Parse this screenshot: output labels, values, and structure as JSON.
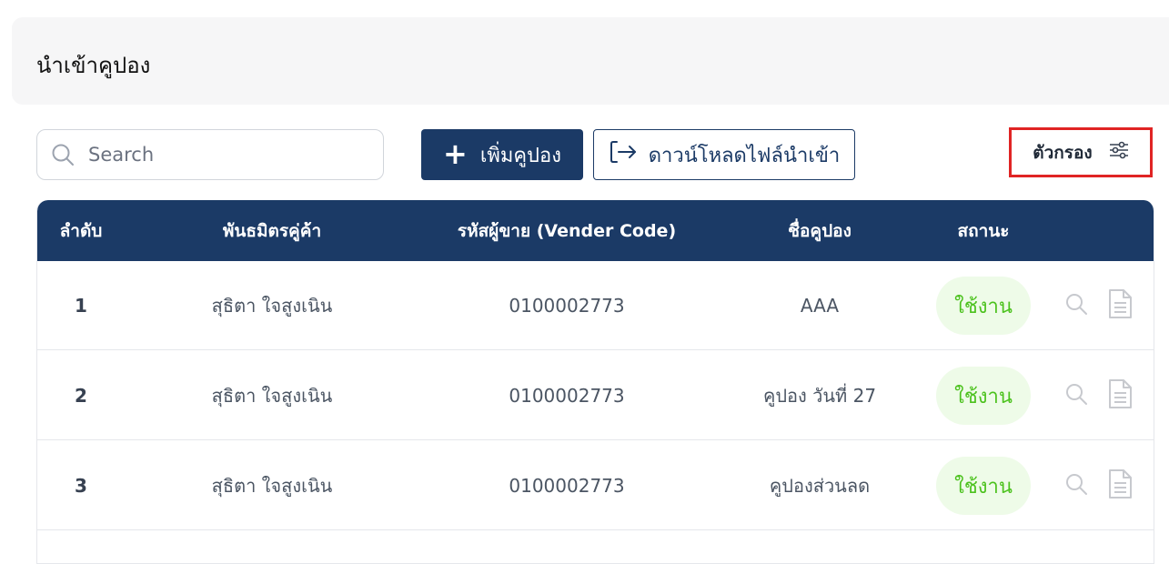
{
  "page": {
    "title": "นำเข้าคูปอง"
  },
  "toolbar": {
    "search_placeholder": "Search",
    "add_label": "เพิ่มคูปอง",
    "download_label": "ดาวน์โหลดไฟล์นำเข้า",
    "filter_label": "ตัวกรอง"
  },
  "table": {
    "headers": [
      "ลำดับ",
      "พันธมิตรคู่ค้า",
      "รหัสผู้ขาย (Vender Code)",
      "ชื่อคูปอง",
      "สถานะ"
    ],
    "rows": [
      {
        "no": "1",
        "partner": "สุธิตา ใจสูงเนิน",
        "vendor_code": "0100002773",
        "coupon_name": "AAA",
        "status": "ใช้งาน"
      },
      {
        "no": "2",
        "partner": "สุธิตา ใจสูงเนิน",
        "vendor_code": "0100002773",
        "coupon_name": "คูปอง วันที่ 27",
        "status": "ใช้งาน"
      },
      {
        "no": "3",
        "partner": "สุธิตา ใจสูงเนิน",
        "vendor_code": "0100002773",
        "coupon_name": "คูปองส่วนลด",
        "status": "ใช้งาน"
      }
    ]
  },
  "colors": {
    "primary": "#1b3a66",
    "status_active_text": "#4cc21e",
    "status_active_bg": "#eefbe8",
    "highlight": "#e02424"
  },
  "icons": {
    "search": "search-icon",
    "add": "plus-icon",
    "download": "import-arrow-icon",
    "filter": "sliders-icon",
    "row_view": "magnifier-icon",
    "row_doc": "document-icon"
  }
}
